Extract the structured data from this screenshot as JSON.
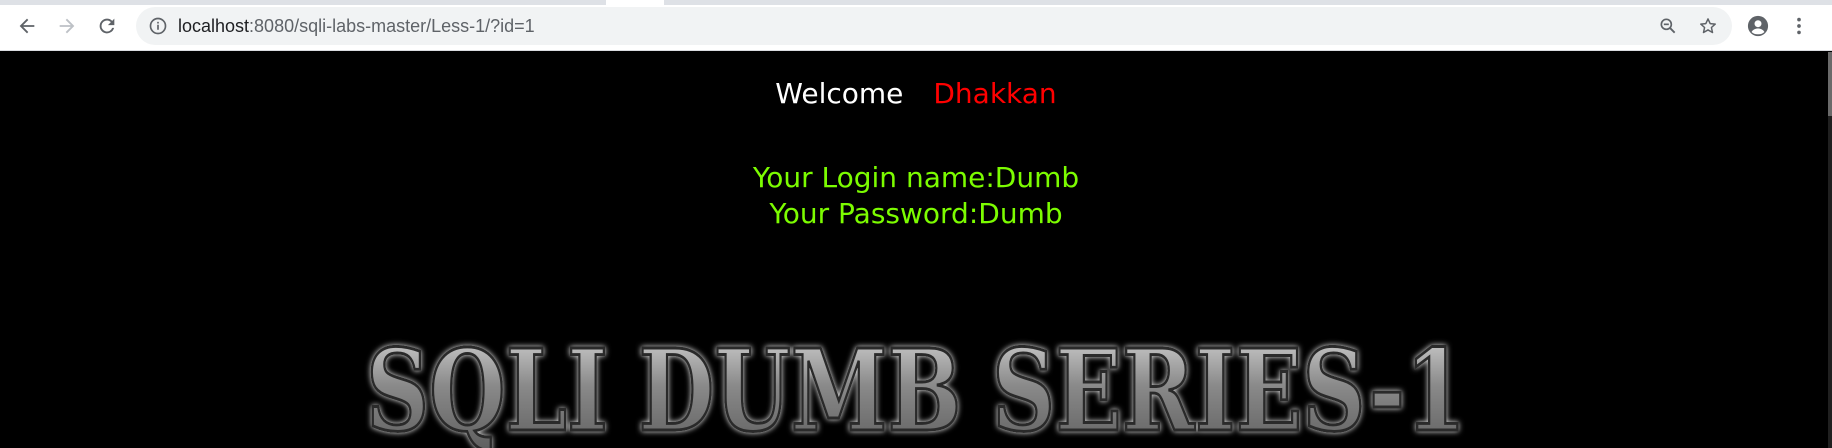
{
  "browser": {
    "url_host": "localhost",
    "url_rest": ":8080/sqli-labs-master/Less-1/?id=1"
  },
  "page": {
    "welcome_text": "Welcome",
    "welcome_name": "Dhakkan",
    "login_name_line": "Your Login name:Dumb",
    "password_line": "Your Password:Dumb",
    "banner_title": "SQLI DUMB SERIES-1"
  },
  "colors": {
    "background": "#000000",
    "welcome": "#ffffff",
    "name": "#ff0000",
    "login_text": "#7cfc00"
  }
}
